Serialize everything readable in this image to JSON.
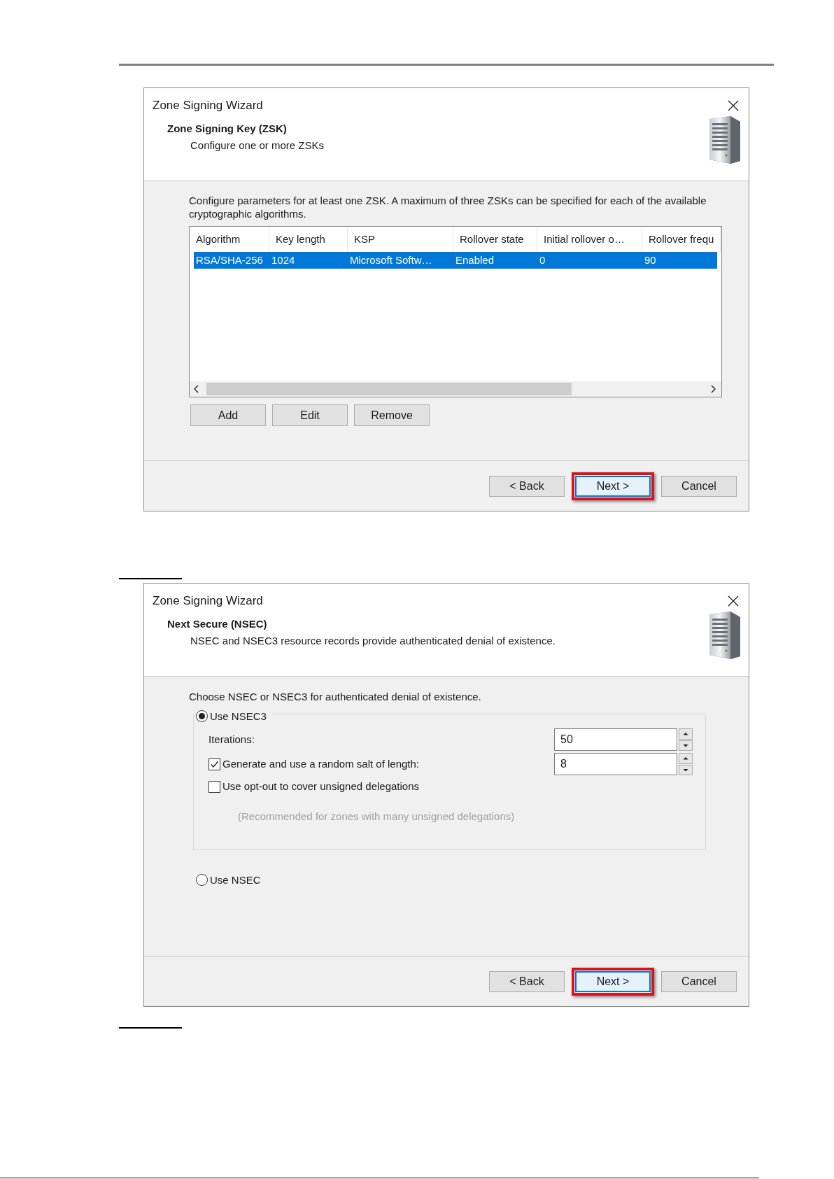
{
  "dialogs": [
    {
      "kind": "zsk",
      "title": "Zone Signing Wizard",
      "heading": "Zone Signing Key (ZSK)",
      "subheading": "Configure one or more ZSKs",
      "intro": "Configure parameters for at least one ZSK. A maximum of three ZSKs can be specified for each of the available cryptographic algorithms.",
      "table": {
        "columns": [
          "Algorithm",
          "Key length",
          "KSP",
          "Rollover state",
          "Initial rollover o…",
          "Rollover frequ"
        ],
        "rows": [
          {
            "cells": [
              "RSA/SHA-256",
              "1024",
              "Microsoft Softw…",
              "Enabled",
              "0",
              "90"
            ],
            "selected": true
          }
        ]
      },
      "list_buttons": [
        "Add",
        "Edit",
        "Remove"
      ],
      "footer_buttons": [
        {
          "label": "< Back",
          "highlighted": false
        },
        {
          "label": "Next >",
          "highlighted": true
        },
        {
          "label": "Cancel",
          "highlighted": false
        }
      ]
    },
    {
      "kind": "nsec",
      "title": "Zone Signing Wizard",
      "heading": "Next Secure (NSEC)",
      "subheading": "NSEC and NSEC3 resource records provide authenticated denial of existence.",
      "intro": "Choose NSEC or NSEC3 for authenticated denial of existence.",
      "options": [
        {
          "label": "Use NSEC3",
          "selected": true
        },
        {
          "label": "Use NSEC",
          "selected": false
        }
      ],
      "iterations": {
        "label": "Iterations:",
        "value": "50"
      },
      "salt": {
        "label": "Generate and use a random salt of length:",
        "checked": true,
        "value": "8"
      },
      "opt_out": {
        "label": "Use opt-out to cover unsigned delegations",
        "checked": false
      },
      "note": "(Recommended for zones with many unsigned delegations)",
      "footer_buttons": [
        {
          "label": "< Back",
          "highlighted": false
        },
        {
          "label": "Next >",
          "highlighted": true
        },
        {
          "label": "Cancel",
          "highlighted": false
        }
      ]
    }
  ]
}
